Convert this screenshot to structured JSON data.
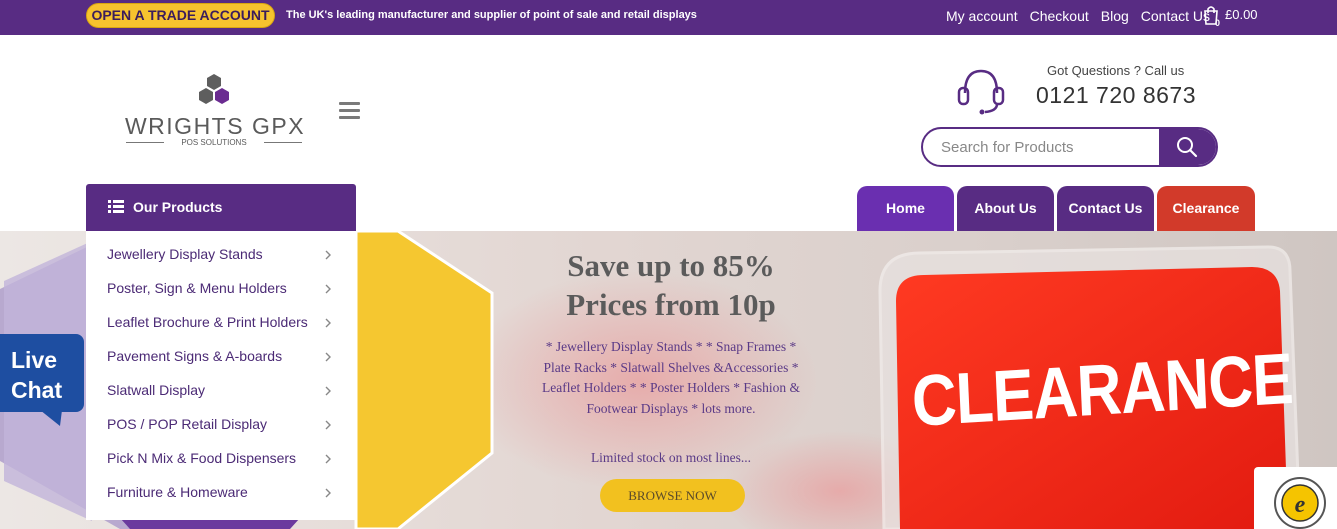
{
  "topbar": {
    "trade_button": "OPEN A TRADE ACCOUNT",
    "tagline": "The UK's leading manufacturer and supplier of point of sale and retail displays",
    "links": [
      "My account",
      "Checkout",
      "Blog",
      "Contact Us"
    ],
    "cart_count": "0",
    "cart_total": "£0.00"
  },
  "header": {
    "logo_text": "WRIGHTS GPX",
    "logo_sub": "POS SOLUTIONS",
    "phone_prompt": "Got Questions ? Call us",
    "phone_number": "0121 720 8673",
    "search_placeholder": "Search for Products"
  },
  "products_menu": {
    "title": "Our Products",
    "items": [
      "Jewellery Display Stands",
      "Poster, Sign & Menu Holders",
      "Leaflet Brochure & Print Holders",
      "Pavement Signs & A-boards",
      "Slatwall Display",
      "POS / POP Retail Display",
      "Pick N Mix & Food Dispensers",
      "Furniture & Homeware"
    ]
  },
  "nav": {
    "tabs": [
      {
        "label": "Home",
        "color": "#6a2fb0"
      },
      {
        "label": "About Us",
        "color": "#582c83"
      },
      {
        "label": "Contact Us",
        "color": "#582c83"
      },
      {
        "label": "Clearance",
        "color": "#d23a2a"
      }
    ]
  },
  "hero": {
    "title_line1": "Save up to 85%",
    "title_line2": "Prices from 10p",
    "description": "* Jewellery Display Stands * * Snap Frames * Plate Racks * Slatwall Shelves &Accessories * Leaflet Holders * * Poster Holders * Fashion & Footwear Displays * lots more.",
    "stock_note": "Limited stock on most lines...",
    "browse_button": "BROWSE NOW",
    "clearance_sign": "CLEARANCE"
  },
  "livechat": {
    "line1": "Live",
    "line2": "Chat"
  },
  "colors": {
    "brand_purple": "#582c83",
    "accent_yellow": "#f7c32e",
    "clearance_red": "#d23a2a",
    "livechat_blue": "#1e4ea1"
  }
}
